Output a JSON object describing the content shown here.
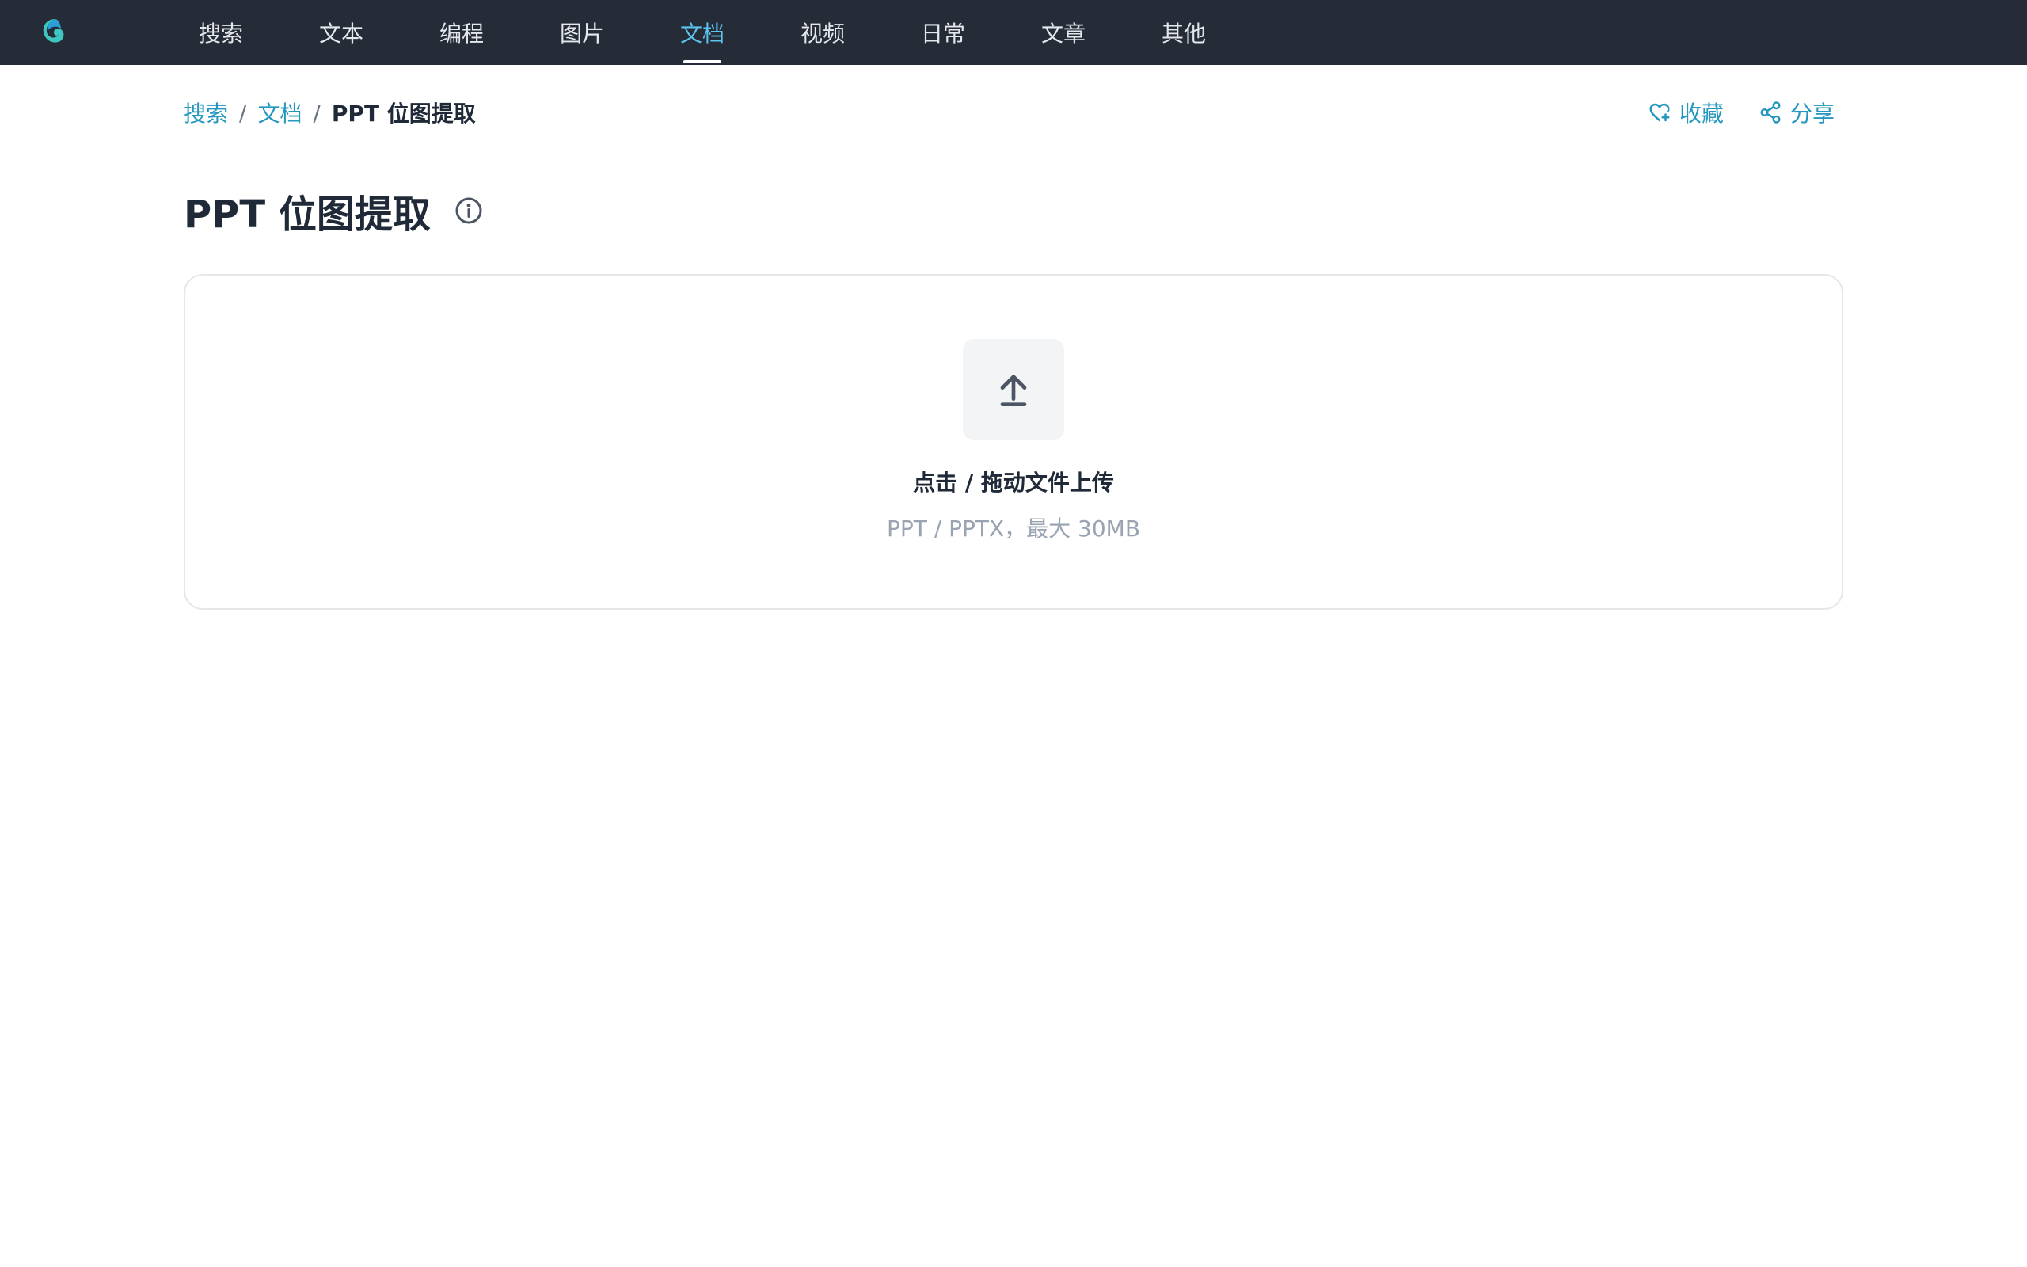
{
  "colors": {
    "topbar_bg": "#252b37",
    "nav_active": "#5cc3ee",
    "link": "#2596be",
    "title": "#1f2937",
    "muted": "#9aa3b2"
  },
  "header": {
    "logo_icon": "app-logo-icon",
    "nav": [
      {
        "label": "搜索",
        "active": false
      },
      {
        "label": "文本",
        "active": false
      },
      {
        "label": "编程",
        "active": false
      },
      {
        "label": "图片",
        "active": false
      },
      {
        "label": "文档",
        "active": true
      },
      {
        "label": "视频",
        "active": false
      },
      {
        "label": "日常",
        "active": false
      },
      {
        "label": "文章",
        "active": false
      },
      {
        "label": "其他",
        "active": false
      }
    ]
  },
  "breadcrumb": {
    "items": [
      "搜索",
      "文档"
    ],
    "separator": "/",
    "current": "PPT 位图提取"
  },
  "actions": {
    "favorite": {
      "label": "收藏",
      "icon": "heart-plus-icon"
    },
    "share": {
      "label": "分享",
      "icon": "share-icon"
    }
  },
  "page": {
    "title": "PPT 位图提取",
    "info_icon": "info-icon"
  },
  "upload": {
    "icon": "upload-icon",
    "title": "点击 / 拖动文件上传",
    "hint": "PPT / PPTX，最大 30MB"
  }
}
